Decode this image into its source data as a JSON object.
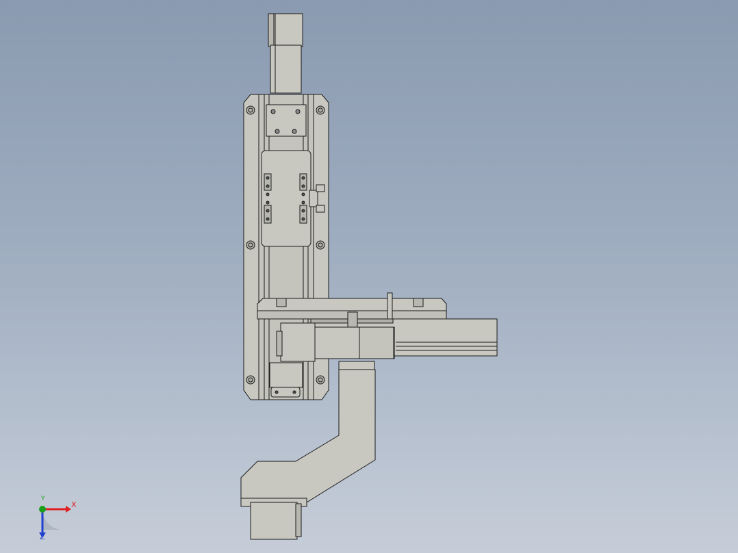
{
  "viewport": {
    "background_top": "#8a9ab0",
    "background_bottom": "#c6cdd8"
  },
  "model": {
    "part_fill": "#c8c8c0",
    "part_edge": "#1a1a1a",
    "part_shadow": "#a8a8a0"
  },
  "triad": {
    "x_label": "X",
    "y_label": "Y",
    "z_label": "Z",
    "x_color": "#e02020",
    "y_color": "#1aa01a",
    "z_color": "#2040d0"
  }
}
